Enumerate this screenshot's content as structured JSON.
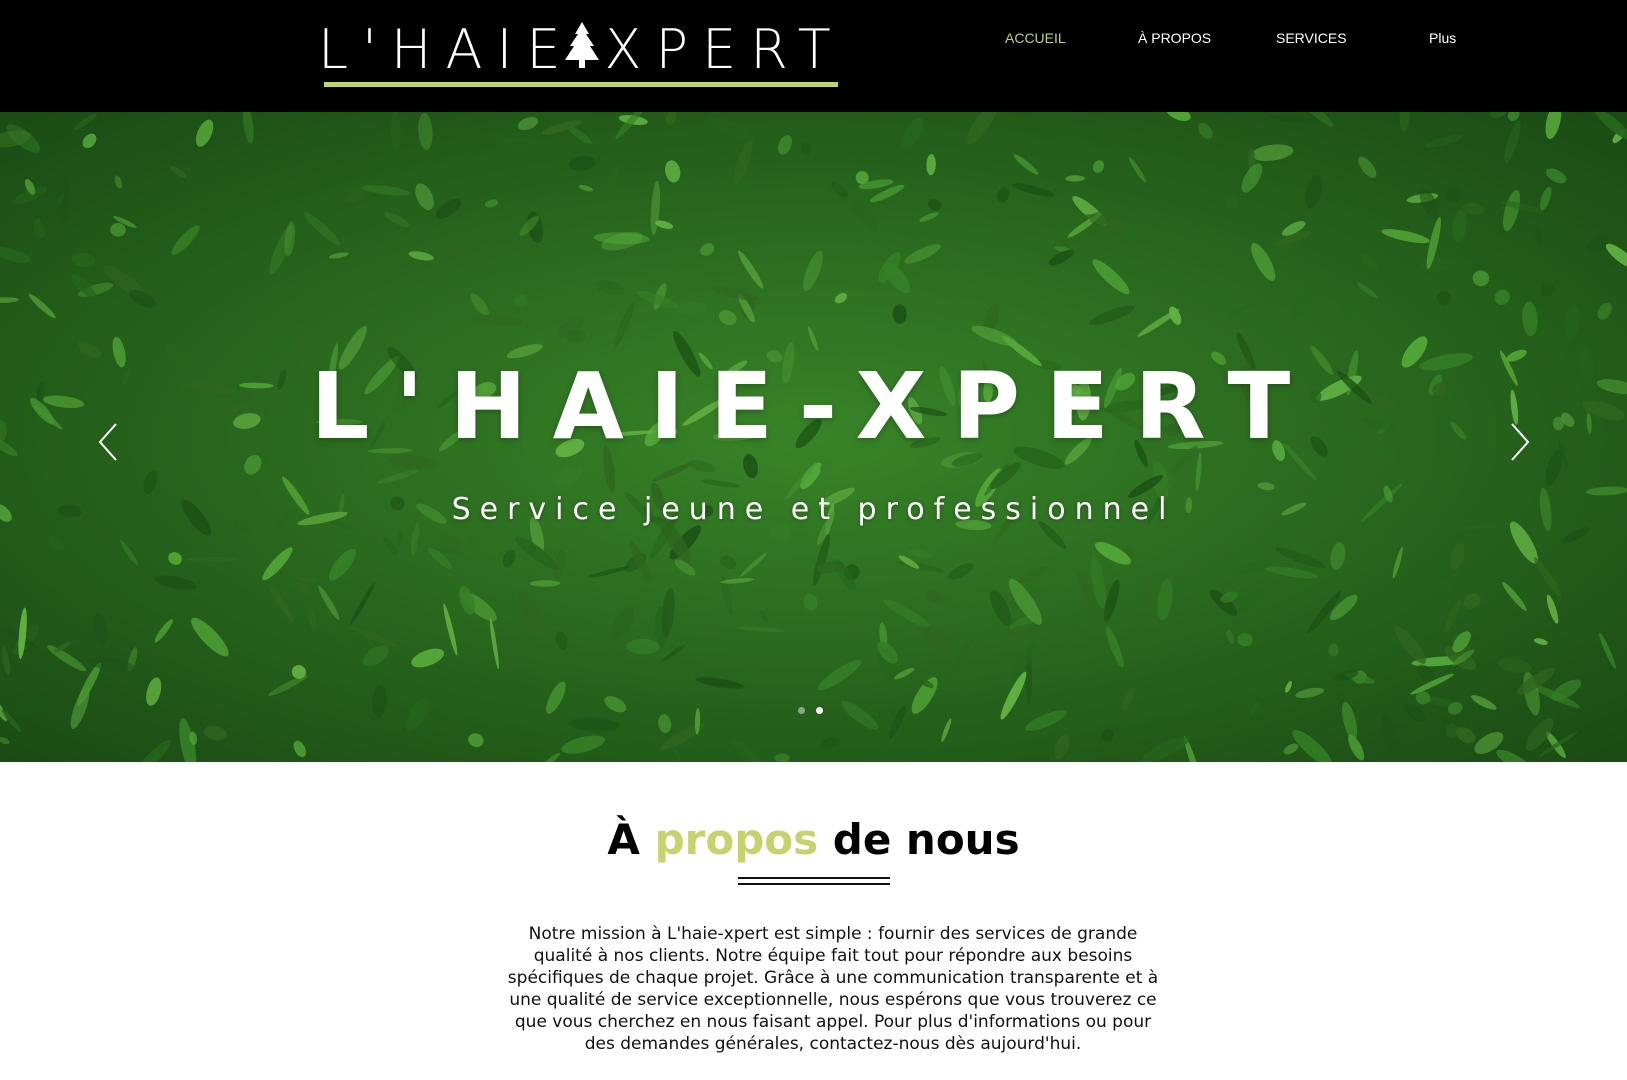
{
  "header": {
    "logo_text": "L'HAIEXPERT",
    "logo_icon": "tree-icon",
    "nav": [
      {
        "label": "ACCUEIL",
        "active": true
      },
      {
        "label": "À PROPOS",
        "active": false
      },
      {
        "label": "SERVICES",
        "active": false
      },
      {
        "label": "Plus",
        "active": false
      }
    ]
  },
  "hero": {
    "title": "L'HAIE-XPERT",
    "subtitle": "Service jeune et professionnel",
    "prev_icon": "chevron-left-icon",
    "next_icon": "chevron-right-icon",
    "slides_total": 2,
    "active_slide": 2
  },
  "about": {
    "title_before": "À",
    "title_accent": "propos",
    "title_after": "de nous",
    "body": "Notre mission à L'haie-xpert est simple : fournir des services de grande qualité à nos clients. Notre équipe fait tout pour répondre aux besoins spécifiques de chaque projet. Grâce à une communication transparente et à une qualité de service exceptionnelle, nous espérons que vous trouverez ce que vous cherchez en nous faisant appel. Pour plus d'informations ou pour des demandes générales, contactez-nous dès aujourd'hui."
  },
  "colors": {
    "header_bg": "#000000",
    "accent": "#c6d26b",
    "text_dark": "#111111",
    "foliage": "#2f7a25"
  }
}
